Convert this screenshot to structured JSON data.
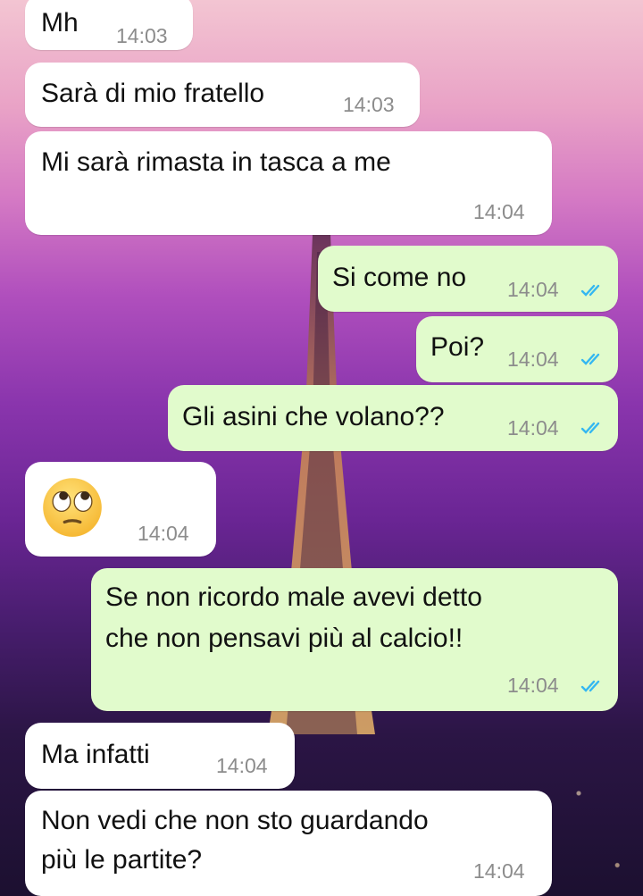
{
  "colors": {
    "incoming_bubble": "#ffffff",
    "outgoing_bubble": "#e1fbcc",
    "read_ticks": "#34b7f1",
    "timestamp": "#8c8c8c"
  },
  "messages": [
    {
      "direction": "incoming",
      "text": "Mh",
      "time": "14:03"
    },
    {
      "direction": "incoming",
      "text": "Sarà di mio fratello",
      "time": "14:03"
    },
    {
      "direction": "incoming",
      "text": "Mi sarà rimasta in tasca a me",
      "time": "14:04"
    },
    {
      "direction": "outgoing",
      "text": "Si come no",
      "time": "14:04",
      "status": "read"
    },
    {
      "direction": "outgoing",
      "text": "Poi?",
      "time": "14:04",
      "status": "read"
    },
    {
      "direction": "outgoing",
      "text": "Gli asini che volano??",
      "time": "14:04",
      "status": "read"
    },
    {
      "direction": "incoming",
      "emoji": "face-with-rolling-eyes",
      "time": "14:04"
    },
    {
      "direction": "outgoing",
      "lines": [
        "Se non ricordo male avevi detto",
        "che non pensavi più al calcio!!"
      ],
      "time": "14:04",
      "status": "read"
    },
    {
      "direction": "incoming",
      "text": "Ma infatti",
      "time": "14:04"
    },
    {
      "direction": "incoming",
      "lines": [
        "Non vedi che non sto guardando",
        "più le partite?"
      ],
      "time": "14:04"
    }
  ]
}
